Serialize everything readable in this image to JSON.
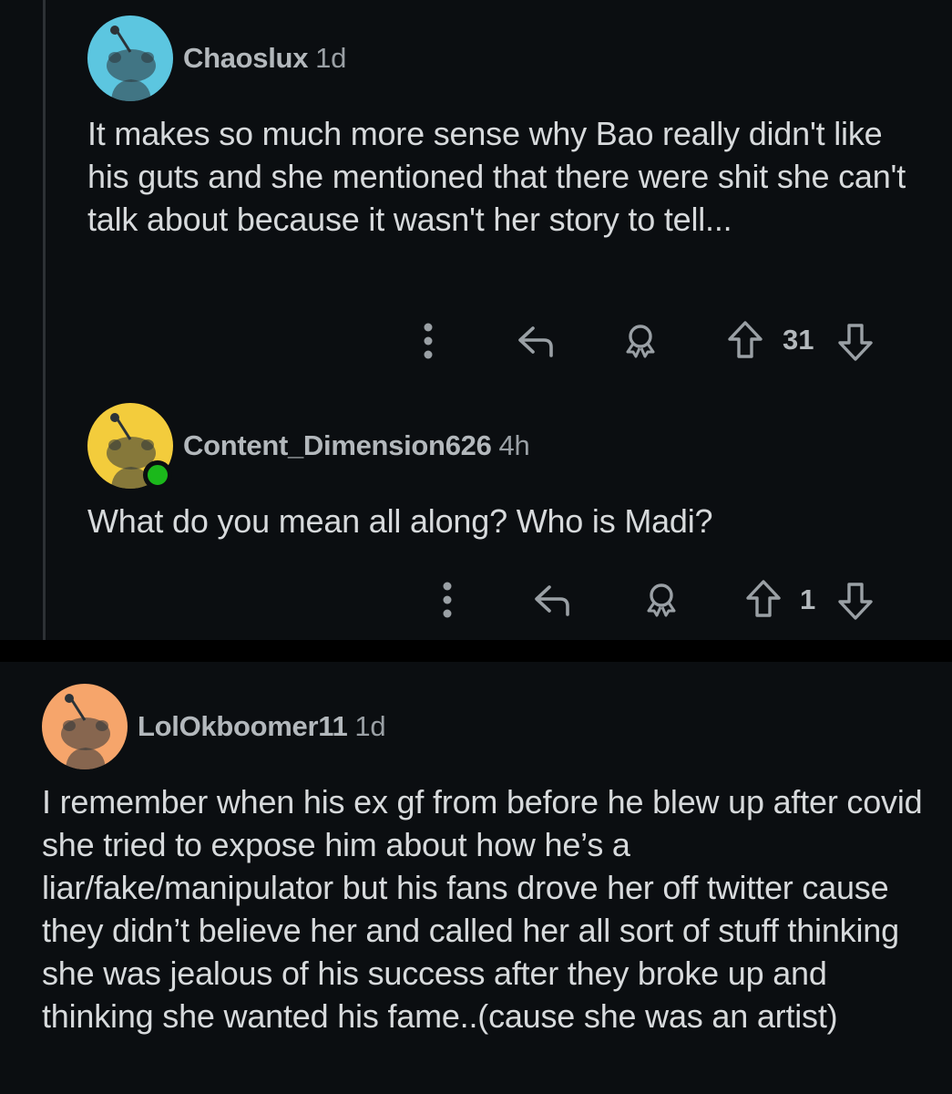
{
  "comments": [
    {
      "username": "Chaoslux",
      "age": "1d",
      "avatar_color": "#5cc6e0",
      "text": "It makes so much more sense why Bao really didn't like his guts and she mentioned that there were shit she can't talk about because it wasn't her story to tell...",
      "score": "31",
      "online": false
    },
    {
      "username": "Content_Dimension626",
      "age": "4h",
      "avatar_color": "#f3cc3c",
      "text": "What do you mean all along? Who is Madi?",
      "score": "1",
      "online": true
    },
    {
      "username": "LolOkboomer11",
      "age": "1d",
      "avatar_color": "#f6a56b",
      "text": "I remember when his ex gf from before he blew up after covid she tried to expose him about how he’s a liar/fake/manipulator but his fans drove her off twitter cause they didn’t believe her and called her all sort of stuff thinking she was jealous of his success after they broke up and thinking she wanted his fame..(cause she was an artist)",
      "online": false
    }
  ],
  "icons": {
    "more": "more-vertical-icon",
    "reply": "reply-icon",
    "award": "award-icon",
    "upvote": "upvote-arrow-icon",
    "downvote": "downvote-arrow-icon",
    "avatar": "snoo-avatar-icon"
  },
  "colors": {
    "background": "#0b0e11",
    "separator": "#000000",
    "text": "#d7dadc",
    "muted": "#9aa0a5",
    "online": "#1bb81b"
  }
}
